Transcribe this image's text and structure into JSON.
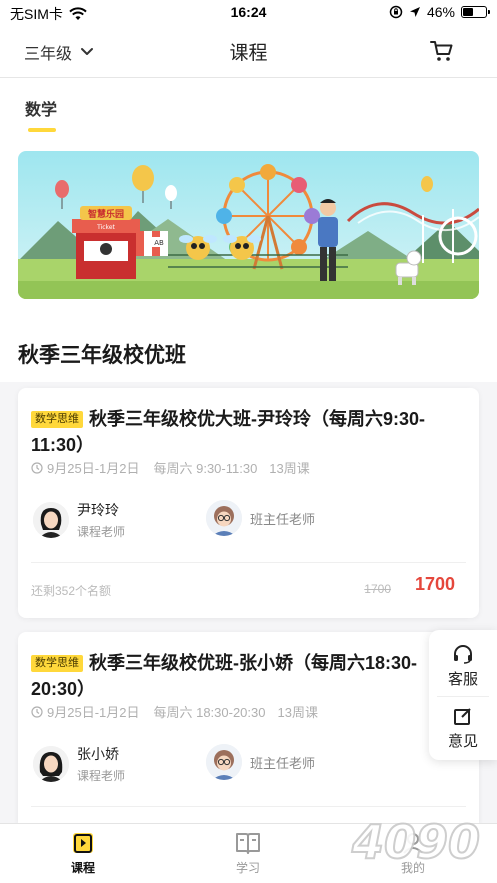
{
  "status_bar": {
    "carrier": "无SIM卡",
    "time": "16:24",
    "battery": "46%",
    "battery_level": 0.46
  },
  "nav": {
    "grade": "三年级",
    "title": "课程"
  },
  "subject_tabs": [
    {
      "label": "数学",
      "active": true
    }
  ],
  "banner": {
    "booth_sign": "智慧乐园",
    "ticket_label": "Ticket",
    "bot_label": "AB"
  },
  "section": {
    "title": "秋季三年级校优班"
  },
  "courses": [
    {
      "tag": "数学思维",
      "title": "秋季三年级校优大班-尹玲玲（每周六9:30-11:30）",
      "dates": "9月25日-1月2日",
      "schedule": "每周六 9:30-11:30",
      "weeks": "13周课",
      "teacher_name": "尹玲玲",
      "teacher_role": "课程老师",
      "assistant": "班主任老师",
      "remaining": "还剩352个名额",
      "original_price": "1700",
      "price": "1700"
    },
    {
      "tag": "数学思维",
      "title": "秋季三年级校优班-张小娇（每周六18:30-20:30）",
      "dates": "9月25日-1月2日",
      "schedule": "每周六 18:30-20:30",
      "weeks": "13周课",
      "teacher_name": "张小娇",
      "teacher_role": "课程老师",
      "assistant": "班主任老师"
    }
  ],
  "float_buttons": {
    "service": "客服",
    "feedback": "意见"
  },
  "tab_bar": {
    "courses": "课程",
    "study": "学习",
    "mine": "我的"
  },
  "watermark": "4090",
  "colors": {
    "accent_yellow": "#ffd83b",
    "price_red": "#e5473c"
  }
}
